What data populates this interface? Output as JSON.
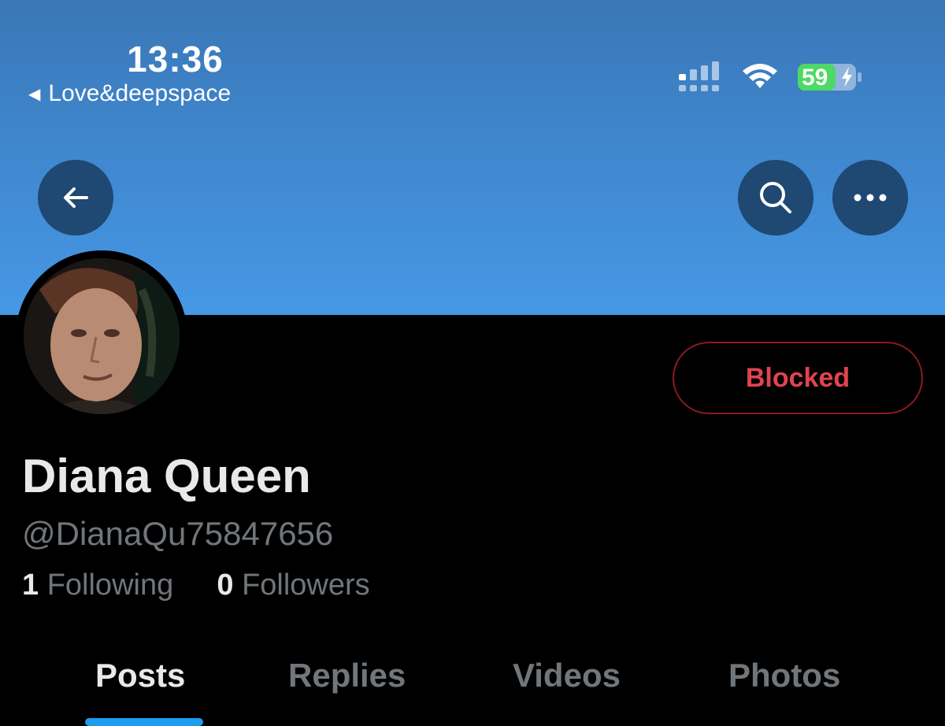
{
  "status_bar": {
    "time": "13:36",
    "back_app_label": "Love&deepspace",
    "battery_level": "59"
  },
  "header": {
    "back_icon": "arrow-left-icon",
    "search_icon": "search-icon",
    "more_icon": "more-horizontal-icon"
  },
  "profile": {
    "name": "Diana Queen",
    "handle": "@DianaQu75847656",
    "following_count": "1",
    "following_label": "Following",
    "followers_count": "0",
    "followers_label": "Followers",
    "blocked_label": "Blocked"
  },
  "tabs": [
    {
      "label": "Posts",
      "active": true
    },
    {
      "label": "Replies",
      "active": false
    },
    {
      "label": "Videos",
      "active": false
    },
    {
      "label": "Photos",
      "active": false
    }
  ],
  "colors": {
    "accent": "#1d9bf0",
    "blocked_text": "#e0444f",
    "battery_green": "#4cd964"
  }
}
